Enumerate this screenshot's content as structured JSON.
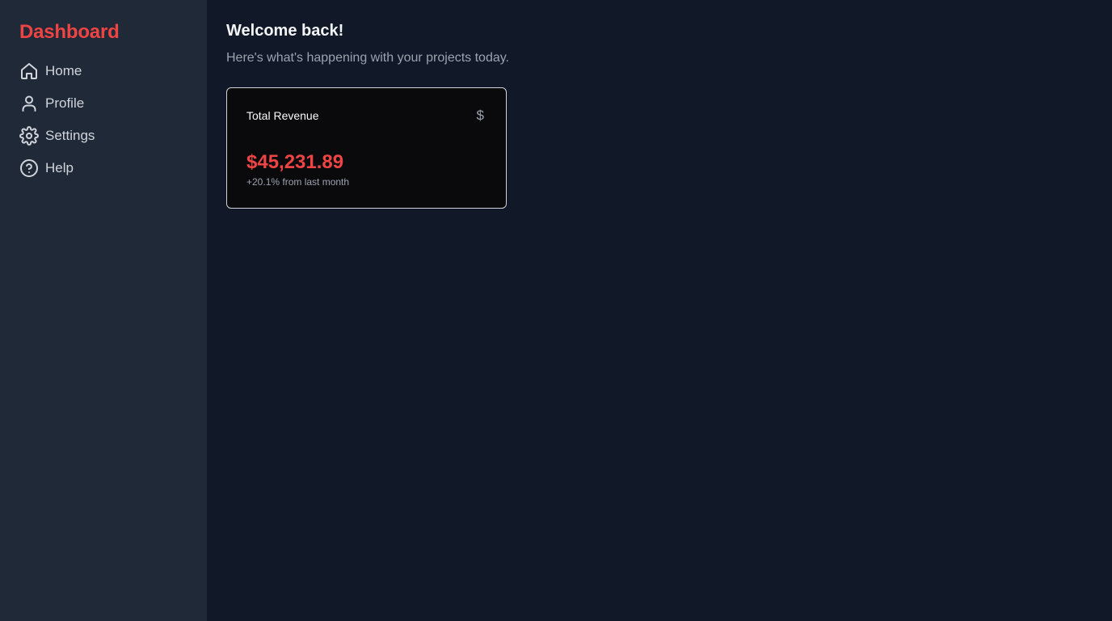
{
  "sidebar": {
    "brand": "Dashboard",
    "items": [
      {
        "label": "Home",
        "icon": "home-icon"
      },
      {
        "label": "Profile",
        "icon": "user-icon"
      },
      {
        "label": "Settings",
        "icon": "gear-icon"
      },
      {
        "label": "Help",
        "icon": "help-circle-icon"
      }
    ]
  },
  "main": {
    "title": "Welcome back!",
    "subtitle": "Here's what's happening with your projects today.",
    "card": {
      "title": "Total Revenue",
      "icon_glyph": "$",
      "value": "$45,231.89",
      "change": "+20.1% from last month"
    }
  },
  "colors": {
    "accent": "#ef4444",
    "sidebar_bg": "#1f2937",
    "page_bg": "#111827",
    "card_bg": "#0a0a0c"
  }
}
